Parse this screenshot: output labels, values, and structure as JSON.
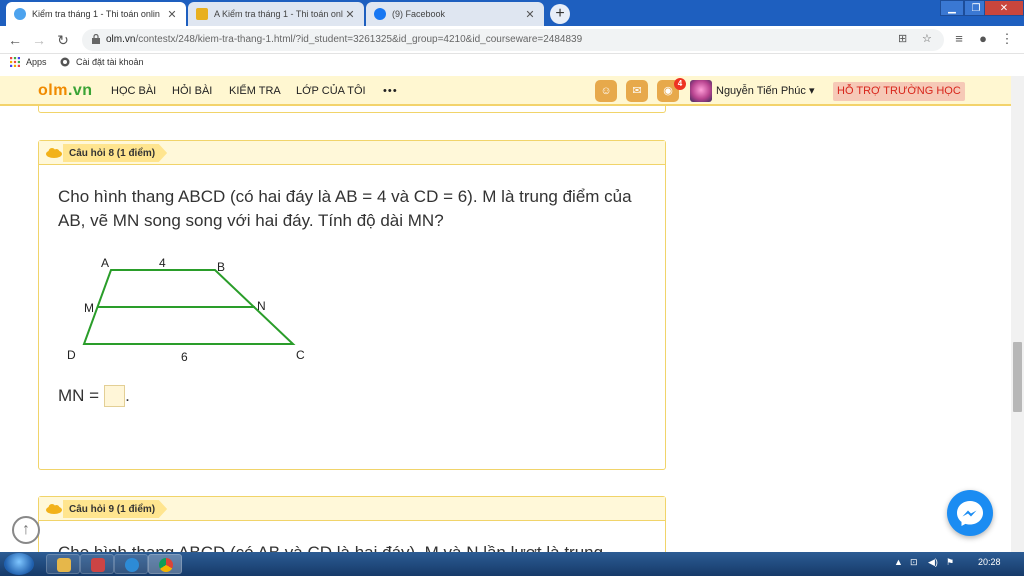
{
  "browser": {
    "tabs": [
      {
        "title": "Kiểm tra tháng 1 - Thi toán onlin"
      },
      {
        "title": "A Kiểm tra tháng 1 - Thi toán onl"
      },
      {
        "title": "(9) Facebook"
      }
    ],
    "url_host": "olm.vn",
    "url_path": "/contestx/248/kiem-tra-thang-1.html/?id_student=3261325&id_group=4210&id_courseware=2484839",
    "bookmarks": [
      {
        "label": "Apps"
      },
      {
        "label": "Cài đặt tài khoản"
      }
    ]
  },
  "site": {
    "logo_left": "olm",
    "logo_right": ".vn",
    "nav": [
      "HỌC BÀI",
      "HỎI BÀI",
      "KIỂM TRA",
      "LỚP CỦA TÔI",
      "• • •"
    ],
    "notification_count": "4",
    "user_name": "Nguyễn Tiến Phúc ▾",
    "support_label": "HỖ TRỢ TRƯỜNG HỌC"
  },
  "questions": [
    {
      "label": "Câu hỏi 8 (1 điểm)",
      "text": "Cho hình thang ABCD (có hai đáy là AB = 4 và CD = 6). M là trung điểm của AB, vẽ MN song song với hai đáy. Tính độ dài MN?",
      "figure": {
        "A": "A",
        "B": "B",
        "C": "C",
        "D": "D",
        "M": "M",
        "N": "N",
        "top_len": "4",
        "bottom_len": "6"
      },
      "answer_prefix": "MN =",
      "answer_suffix": ".",
      "answer_value": ""
    },
    {
      "label": "Câu hỏi 9 (1 điểm)",
      "text": "Cho hình thang ABCD (có AB và CD là hai đáy). M và N lần lượt là trung"
    }
  ],
  "taskbar": {
    "clock": "20:28"
  },
  "colors": {
    "nav_bg": "#fff7d1",
    "card_border": "#f1d46a",
    "accent_orange": "#f08a00",
    "trapezoid": "#2a9d2a",
    "support_text": "#d8261b"
  }
}
